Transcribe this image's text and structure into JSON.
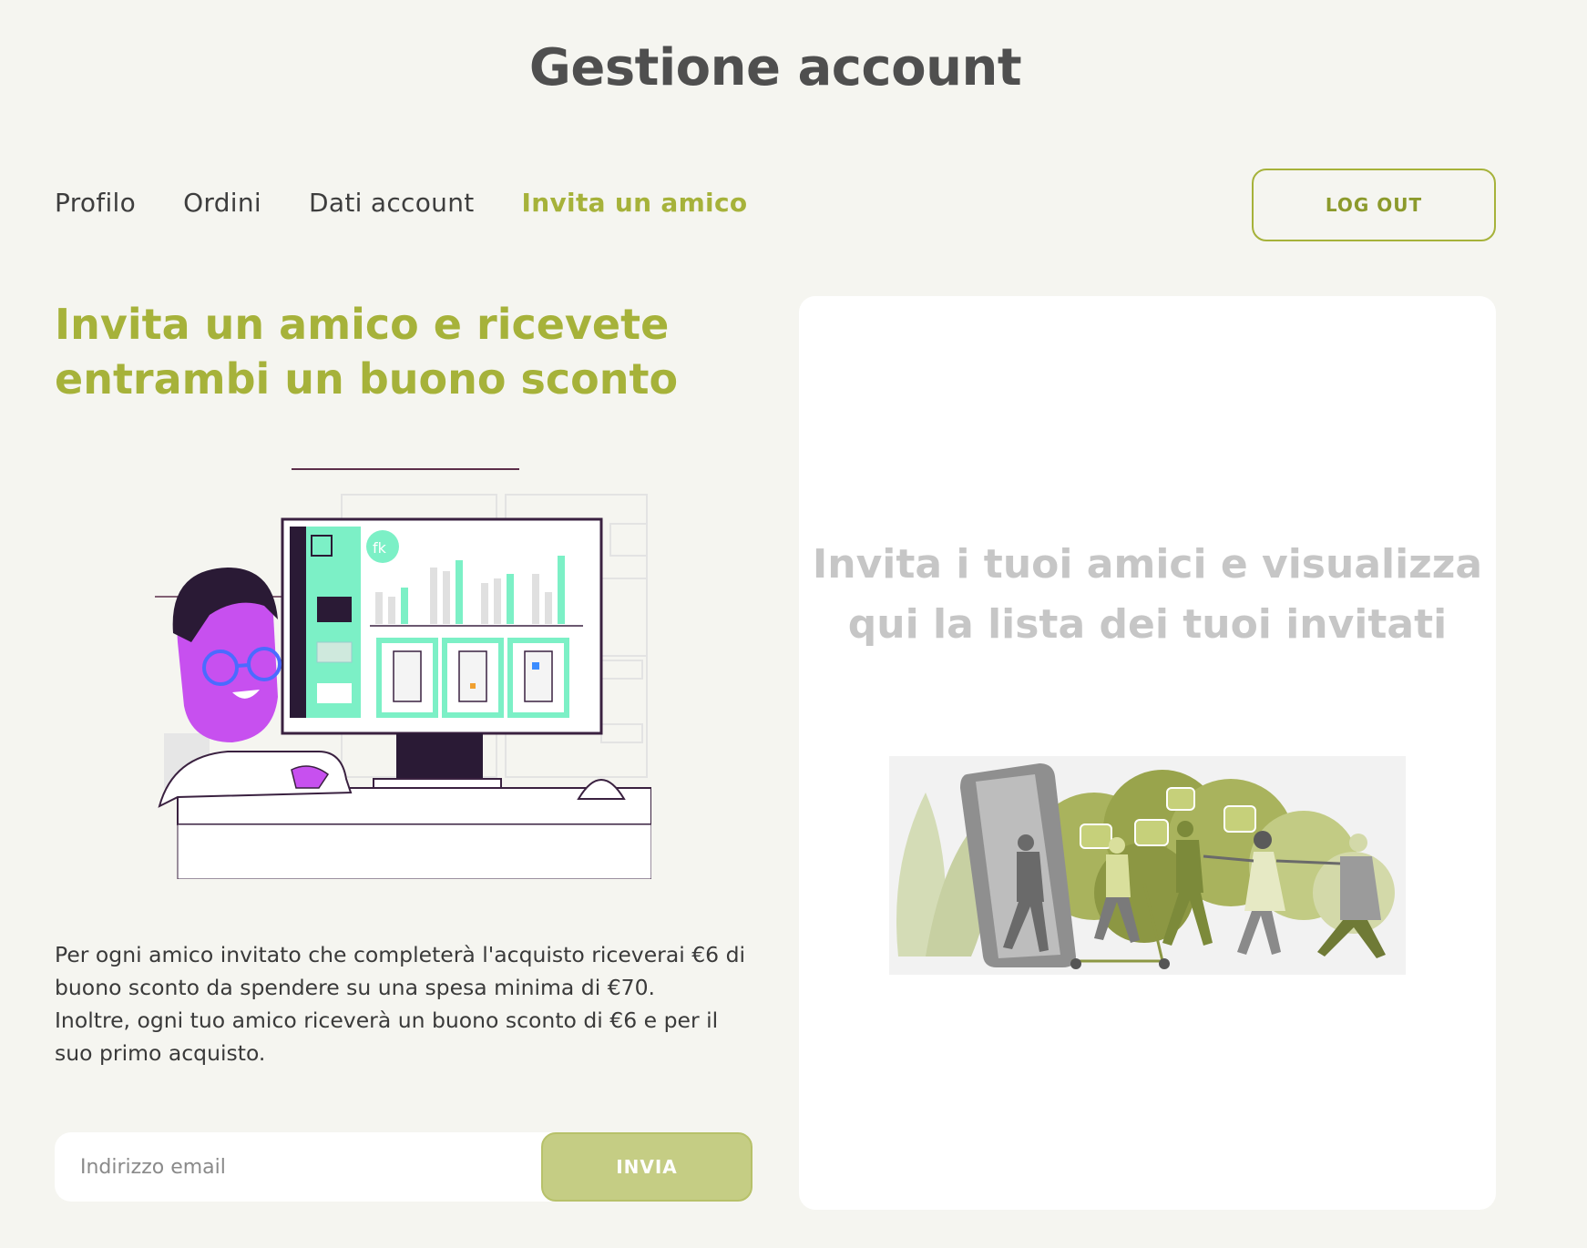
{
  "page": {
    "title": "Gestione account"
  },
  "tabs": [
    {
      "label": "Profilo",
      "active": false
    },
    {
      "label": "Ordini",
      "active": false
    },
    {
      "label": "Dati account",
      "active": false
    },
    {
      "label": "Invita un amico",
      "active": true
    }
  ],
  "header": {
    "logout_label": "LOG OUT"
  },
  "invite": {
    "headline": "Invita un amico e ricevete entrambi un buono sconto",
    "illustration_badge": "fk",
    "description_1": "Per ogni amico invitato che completerà l'acquisto riceverai €6 di buono sconto da spendere su una spesa minima di €70.",
    "description_2": "Inoltre, ogni tuo amico riceverà un buono sconto di €6 e per il suo primo acquisto.",
    "email_placeholder": "Indirizzo email",
    "send_label": "INVIA"
  },
  "invited_panel": {
    "empty_text": "Invita i tuoi amici e visualizza qui la lista dei tuoi invitati"
  },
  "colors": {
    "accent": "#a6b23a",
    "button_fill": "#c5cd84",
    "background": "#f5f5f0",
    "panel": "#ffffff",
    "empty_text": "#c6c6c6"
  }
}
